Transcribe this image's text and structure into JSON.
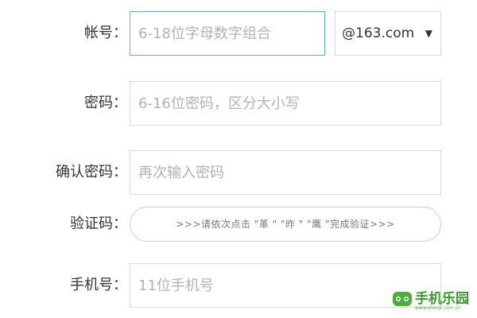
{
  "form": {
    "account": {
      "label": "帐号：",
      "placeholder": "6-18位字母数字组合",
      "domain": "@163.com"
    },
    "password": {
      "label": "密码：",
      "placeholder": "6-16位密码，区分大小写"
    },
    "confirm": {
      "label": "确认密码：",
      "placeholder": "再次输入密码"
    },
    "captcha": {
      "label": "验证码：",
      "instruction": ">>>请依次点击 \"革 \" \"昨 \" \"鹰 \"完成验证>>>"
    },
    "phone": {
      "label": "手机号：",
      "placeholder": "11位手机号"
    }
  },
  "watermark": {
    "brand": "手机乐园",
    "url": "www.shouji.com.cn"
  },
  "icons": {
    "dropdown": "caret-down-icon"
  },
  "colors": {
    "focus_border": "#57b1cf",
    "border": "#d9d9d9",
    "placeholder": "#b3b3b3",
    "logo_green": "#3a9c2e"
  }
}
